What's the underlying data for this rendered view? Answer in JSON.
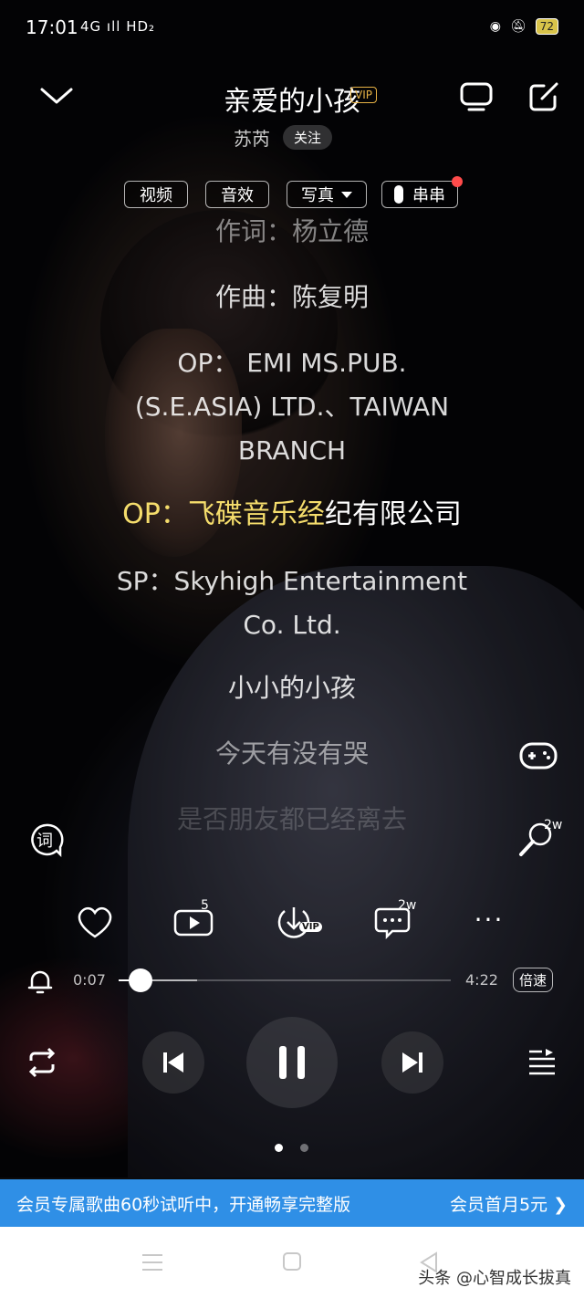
{
  "status": {
    "time": "17:01",
    "network": "4G ıll HD₂",
    "battery": "72"
  },
  "header": {
    "title": "亲爱的小孩",
    "vip_label": "VIP",
    "artist": "苏芮",
    "follow_label": "关注"
  },
  "chips": [
    {
      "label": "视频"
    },
    {
      "label": "音效"
    },
    {
      "label": "写真"
    },
    {
      "label": "串串"
    }
  ],
  "lyrics": {
    "line_lyricist": "作词：杨立德",
    "line_composer": "作曲：陈复明",
    "line_op1": [
      "OP： EMI MS.PUB.",
      "(S.E.ASIA) LTD.、TAIWAN",
      "BRANCH"
    ],
    "line_op2_highlight": "OP：飞碟音乐经",
    "line_op2_rest": "纪有限公司",
    "line_sp": [
      "SP：Skyhigh Entertainment",
      "Co. Ltd."
    ],
    "line_6": "小小的小孩",
    "line_7": "今天有没有哭",
    "line_8": "是否朋友都已经离去"
  },
  "side": {
    "lyrics_label": "词",
    "karaoke_count": "2w"
  },
  "actions": {
    "share_count": "5",
    "comment_count": "2w",
    "download_badge": "VIP"
  },
  "player": {
    "current_time": "0:07",
    "total_time": "4:22",
    "speed_label": "倍速",
    "progress_fraction": 0.065,
    "buffered_fraction": 0.235
  },
  "pager": {
    "count": 2,
    "active": 0
  },
  "banner": {
    "left_text": "会员专属歌曲60秒试听中，开通畅享完整版",
    "right_text": "会员首月5元 ❯"
  },
  "watermark": "头条 @心智成长拔真",
  "colors": {
    "highlight": "#f5dd6c",
    "vip": "#e7b245",
    "banner": "#2f8fe6",
    "badge_dot": "#ff4b4b"
  }
}
